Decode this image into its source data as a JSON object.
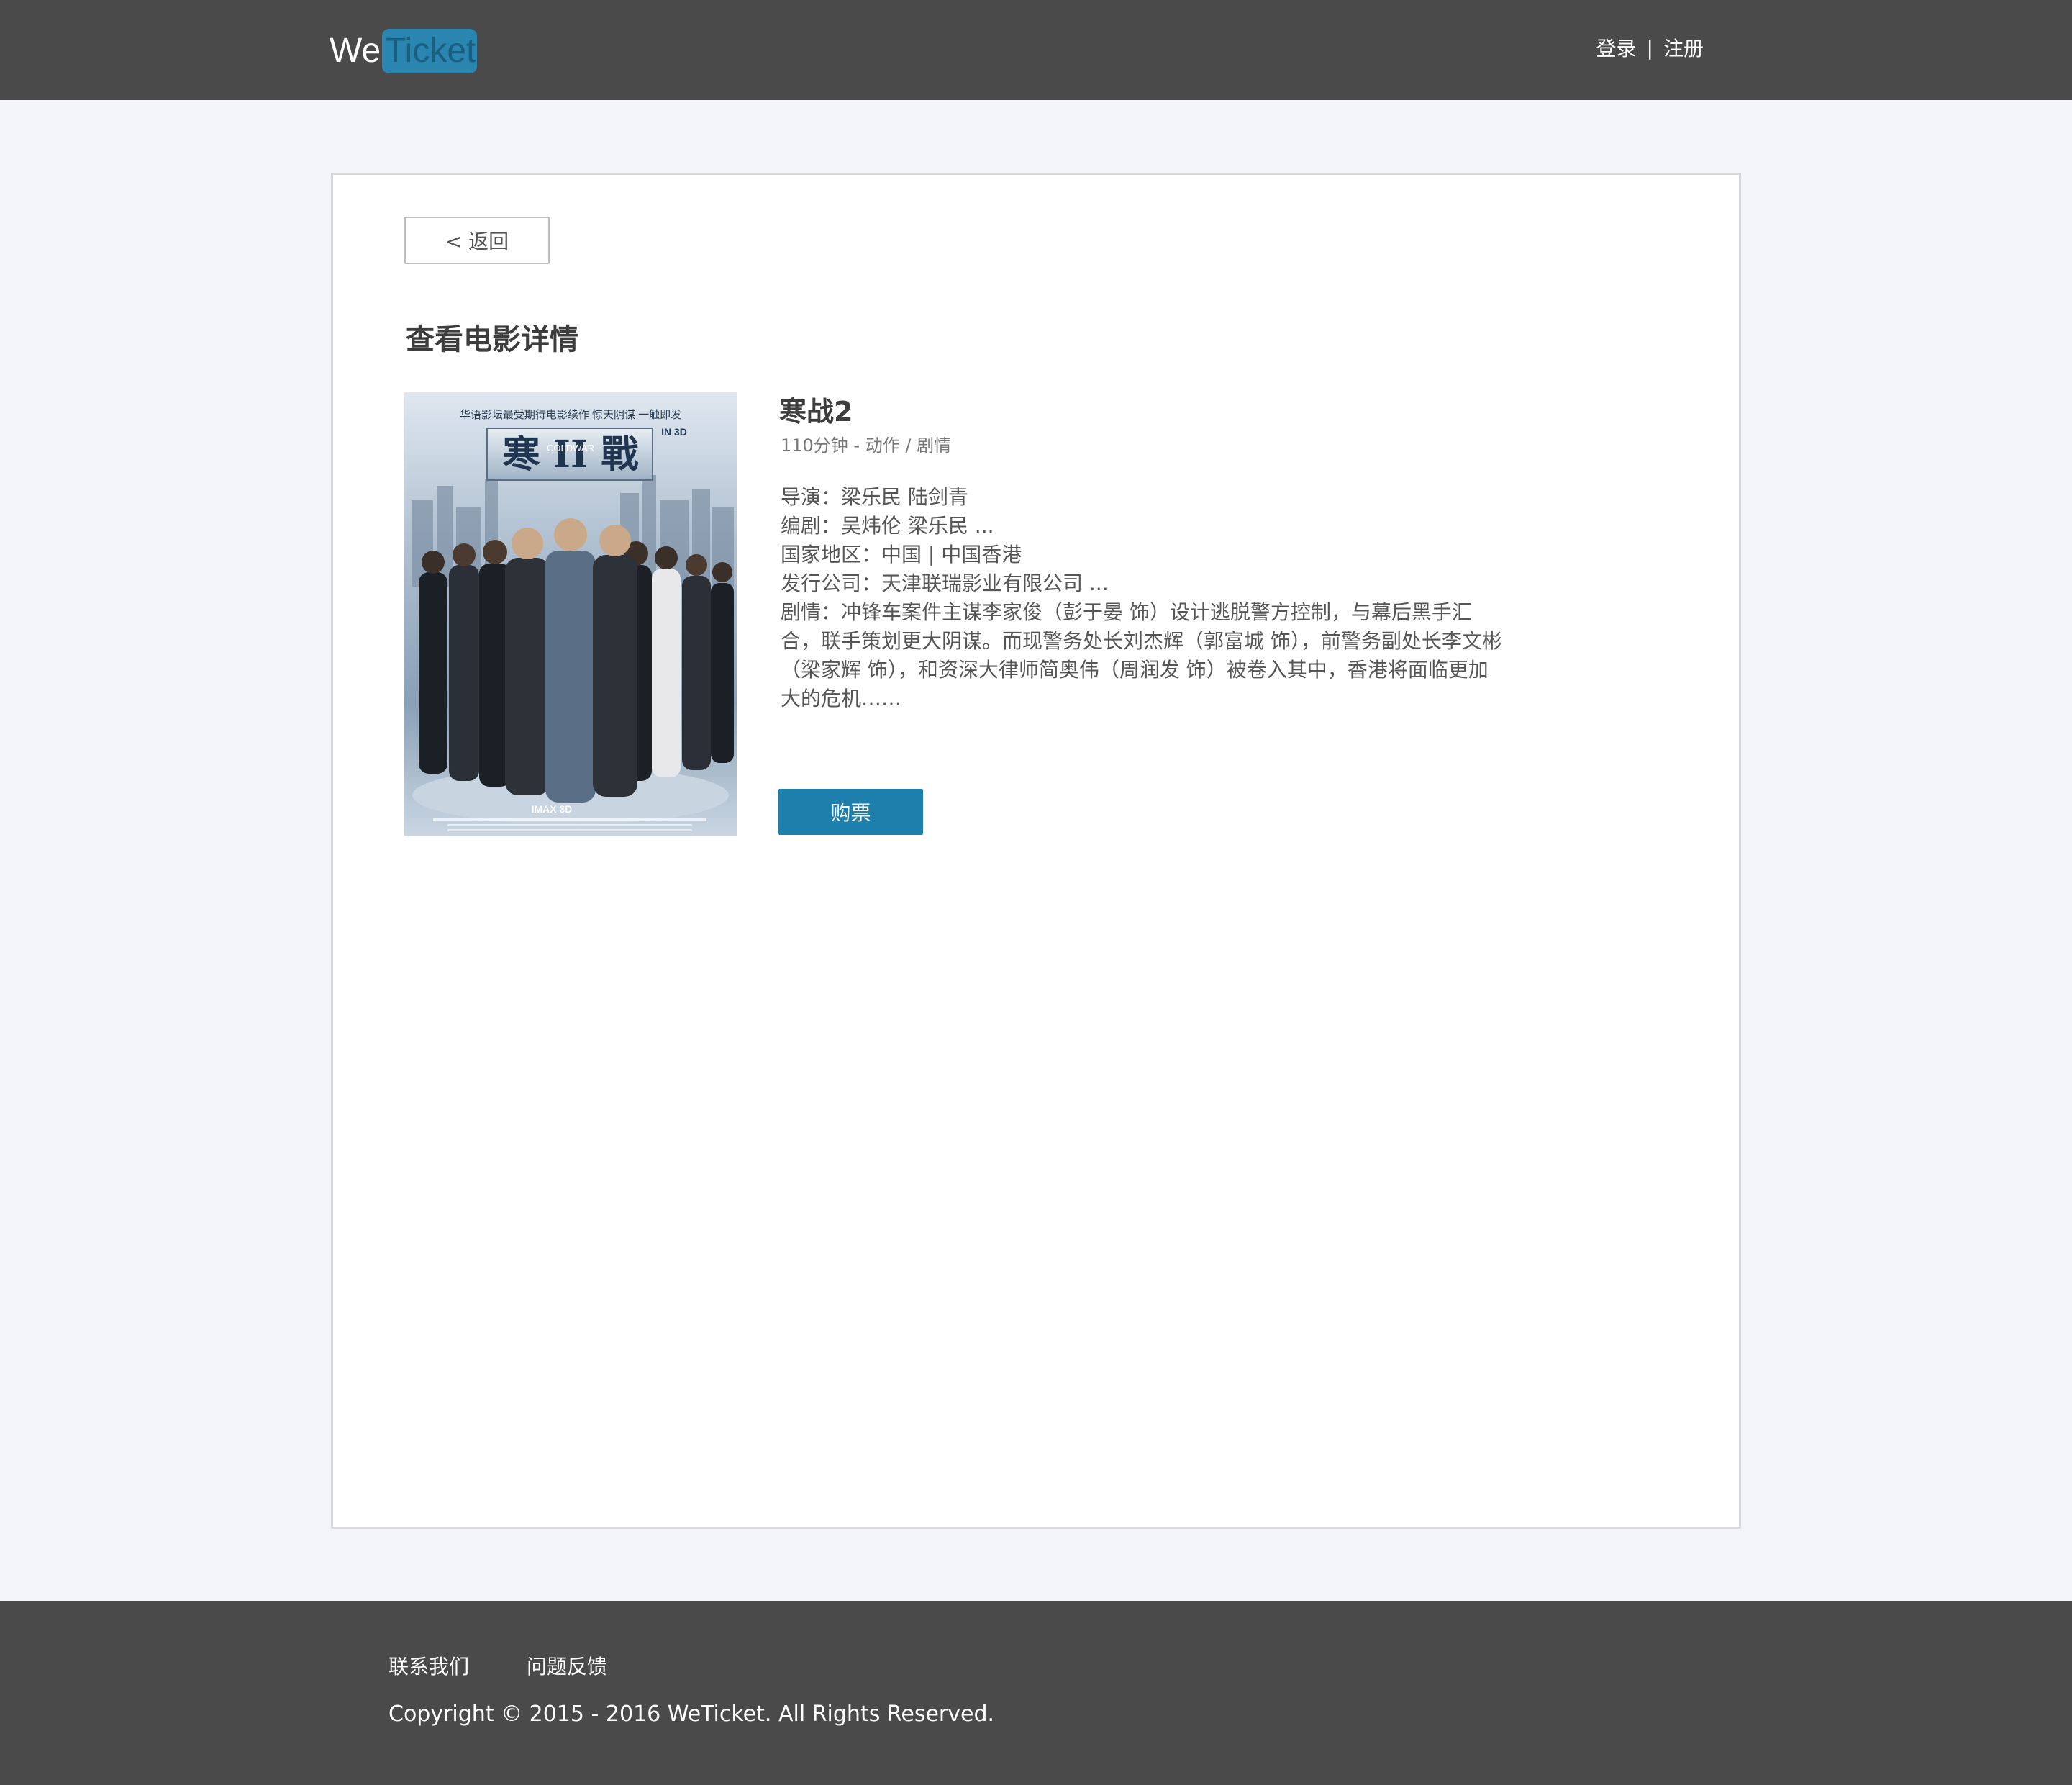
{
  "header": {
    "logo_we": "We",
    "logo_ticket": "Ticket",
    "login": "登录",
    "separator": "|",
    "register": "注册"
  },
  "main": {
    "back_label": "< 返回",
    "page_title": "查看电影详情",
    "movie": {
      "name": "寒战2",
      "meta": "110分钟 - 动作 / 剧情",
      "director": "导演：梁乐民 陆剑青",
      "writer": "编剧：吴炜伦 梁乐民 ...",
      "region": "国家地区：中国 | 中国香港",
      "distributor": "发行公司：天津联瑞影业有限公司 ...",
      "plot": "剧情：冲锋车案件主谋李家俊（彭于晏 饰）设计逃脱警方控制，与幕后黑手汇合，联手策划更大阴谋。而现警务处长刘杰辉（郭富城 饰），前警务副处长李文彬（梁家辉 饰），和资深大律师简奥伟（周润发 饰）被卷入其中，香港将面临更加大的危机……",
      "poster": {
        "tagline": "华语影坛最受期待电影续作  惊天阴谋  一触即发",
        "title_chinese": "寒 II 戰",
        "title_english": "COLDWAR",
        "format": "IN 3D",
        "imax": "IMAX 3D"
      }
    },
    "buy_label": "购票"
  },
  "footer": {
    "contact": "联系我们",
    "feedback": "问题反馈",
    "copyright": "Copyright © 2015 - 2016 WeTicket. All Rights Reserved."
  },
  "colors": {
    "header_bg": "#4a4a4a",
    "page_bg": "#f3f5f8",
    "accent": "#1f7fac",
    "logo_badge": "#2a86b0"
  }
}
